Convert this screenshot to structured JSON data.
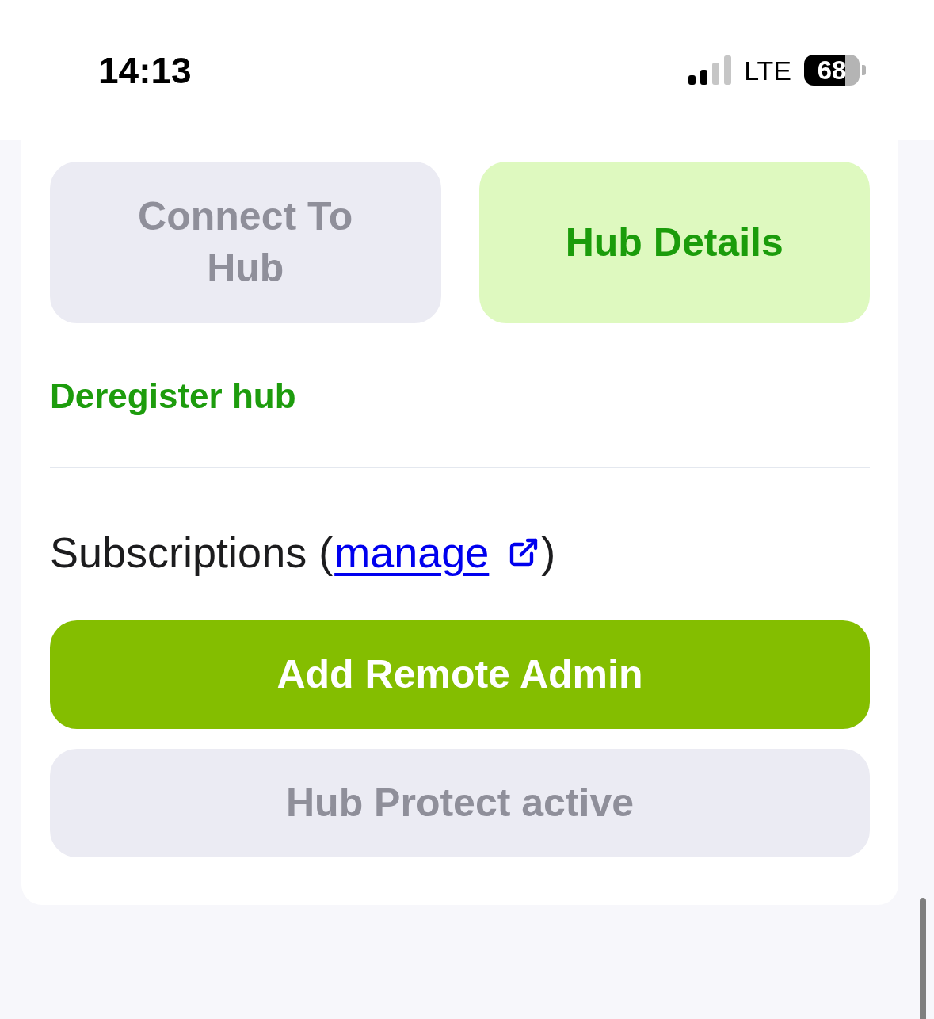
{
  "status_bar": {
    "time": "14:13",
    "network": "LTE",
    "battery": "68"
  },
  "hub_actions": [
    {
      "label": "Connect To Hub",
      "kind": "muted"
    },
    {
      "label": "Hub Details",
      "kind": "tinted"
    }
  ],
  "deregister_link": "Deregister hub",
  "subscriptions": {
    "text_before": "Subscriptions (",
    "link": "manage",
    "text_after": ")"
  },
  "actions": [
    {
      "label": "Add Remote Admin",
      "kind": "filled"
    },
    {
      "label": "Hub Protect active",
      "kind": "muted"
    }
  ]
}
